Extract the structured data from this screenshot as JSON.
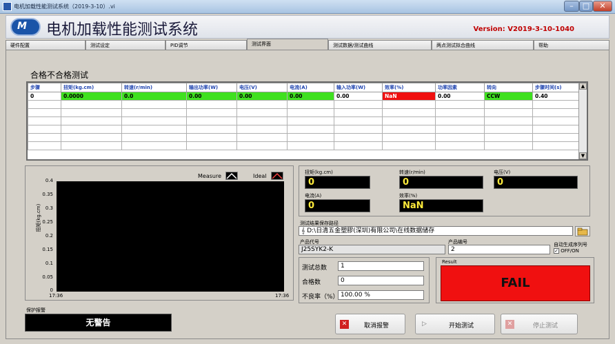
{
  "window": {
    "title": "电机加载性能测试系统（2019-3-10）.vi",
    "min": "–",
    "max": "□",
    "close": "✕"
  },
  "header": {
    "app_title": "电机加载性能测试系统",
    "version_label": "Version:",
    "version": "V2019-3-10-1040"
  },
  "tabs": [
    "硬件配置",
    "测试设定",
    "PID调节",
    "测试界面",
    "测试数据/测试曲线",
    "两点测试拟合曲线",
    "帮助"
  ],
  "section_title": "合格不合格测试",
  "table": {
    "columns": [
      "步骤",
      "扭矩(kg.cm)",
      "转速(r/min)",
      "输出功率(W)",
      "电压(V)",
      "电流(A)",
      "输入功率(W)",
      "效率(%)",
      "功率因素",
      "转向",
      "步骤时间(s)"
    ],
    "rows": [
      [
        "0",
        "0.0000",
        "0.0",
        "0.00",
        "0.00",
        "0.00",
        "0.00",
        "NaN",
        "0.00",
        "CCW",
        "0.40"
      ]
    ]
  },
  "chart": {
    "legend_measure": "Measure",
    "legend_ideal": "Ideal",
    "ylabel": "扭矩(kg.cm)",
    "yticks": [
      "0.4",
      "0.35",
      "0.3",
      "0.25",
      "0.2",
      "0.15",
      "0.1",
      "0.05",
      "0"
    ],
    "x_start": "17:36",
    "x_end": "17:36"
  },
  "chart_data": {
    "type": "line",
    "title": "",
    "xlabel": "",
    "ylabel": "扭矩(kg.cm)",
    "ylim": [
      0,
      0.4
    ],
    "x": [
      "17:36",
      "17:36"
    ],
    "series": [
      {
        "name": "Measure",
        "values": []
      },
      {
        "name": "Ideal",
        "values": []
      }
    ]
  },
  "readouts": {
    "torque_label": "扭矩(kg.cm)",
    "torque": "0",
    "speed_label": "转速(r/min)",
    "speed": "0",
    "voltage_label": "电压(V)",
    "voltage": "0",
    "current_label": "电流(A)",
    "current": "0",
    "efficiency_label": "效率(%)",
    "efficiency": "NaN"
  },
  "save": {
    "path_label": "测试结果保存路径",
    "path_prefix": "𝄞",
    "path": "D:\\日清五金塑膠(深圳)有限公司\\在线数据储存",
    "product_code_label": "产品代号",
    "product_code": "J25SYK2-K",
    "product_no_label": "产品编号",
    "product_no": "2",
    "auto_serial_label": "自动生成序列号",
    "auto_serial_option": "OFF/ON"
  },
  "stats": {
    "total_label": "测试总数",
    "total": "1",
    "pass_label": "合格数",
    "pass": "0",
    "defect_label": "不良率（%）",
    "defect": "100.00  %"
  },
  "result": {
    "label": "Result",
    "value": "FAIL"
  },
  "alarm": {
    "label": "保护报警",
    "value": "无警告"
  },
  "buttons": {
    "cancel_alarm": "取消报警",
    "start_test": "开始测试",
    "stop_test": "停止测试"
  },
  "colors": {
    "pass_green": "#3fe020",
    "fail_red": "#f01010",
    "readout_yellow": "#ffeb3b"
  }
}
